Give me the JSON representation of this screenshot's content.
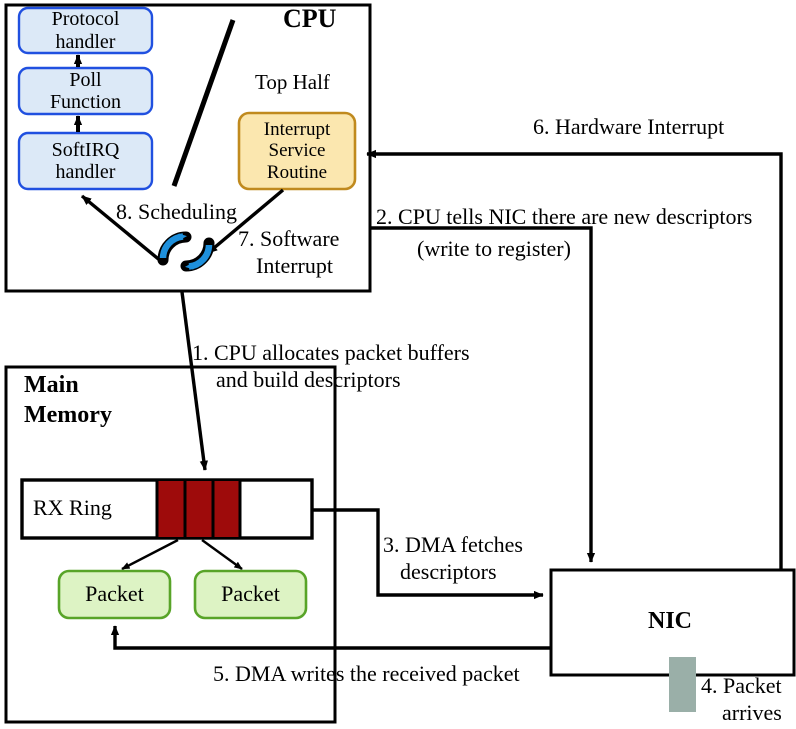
{
  "diagram": {
    "title": "NIC packet receive path (NAPI) block diagram",
    "colors": {
      "blue_fill": "#DCE9F7",
      "blue_stroke": "#2050E0",
      "yellow_fill": "#FBE7AF",
      "yellow_stroke": "#C08A1E",
      "green_fill": "#DDF3C4",
      "green_stroke": "#58A428",
      "red_fill": "#9E0B0B",
      "gray_fill": "#9AAFA8",
      "line": "#000000",
      "background": "#FFFFFF"
    }
  },
  "cpu": {
    "title": "CPU",
    "top_half_label": "Top Half",
    "blocks": [
      {
        "id": "protocol-handler",
        "label": "Protocol\nhandler"
      },
      {
        "id": "poll-function",
        "label": "Poll\nFunction"
      },
      {
        "id": "softirq-handler",
        "label": "SoftIRQ\nhandler"
      },
      {
        "id": "interrupt-service-routine",
        "label": "Interrupt\nService\nRoutine"
      }
    ],
    "step8": "8. Scheduling",
    "step7": "7. Software\nInterrupt",
    "napi_icon": "cycle-arrows-icon"
  },
  "memory": {
    "title": "Main\nMemory",
    "ring": {
      "label": "RX Ring",
      "total_cells": 8,
      "filled_cells": 3,
      "filled_start_index": 4
    },
    "packets": [
      {
        "id": "packet-left",
        "label": "Packet"
      },
      {
        "id": "packet-right",
        "label": "Packet"
      }
    ]
  },
  "nic": {
    "title": "NIC",
    "port_label": "port-connector"
  },
  "steps": [
    {
      "num": 1,
      "text": "1. CPU allocates packet buffers\n     and build descriptors"
    },
    {
      "num": 2,
      "text": "2. CPU tells NIC there are new descriptors\n            (write to register)"
    },
    {
      "num": 3,
      "text": "3. DMA fetches\n     descriptors"
    },
    {
      "num": 4,
      "text": "4. Packet\n    arrives"
    },
    {
      "num": 5,
      "text": "5. DMA writes the received packet"
    },
    {
      "num": 6,
      "text": "6. Hardware Interrupt"
    },
    {
      "num": 7,
      "text": "7. Software\n    Interrupt"
    },
    {
      "num": 8,
      "text": "8. Scheduling"
    }
  ],
  "step_labels": {
    "s1_line1": "1. CPU allocates packet buffers",
    "s1_line2": "and build descriptors",
    "s2_line1": "2. CPU tells NIC there are new descriptors",
    "s2_line2": "(write to register)",
    "s3_line1": "3. DMA fetches",
    "s3_line2": "descriptors",
    "s4_line1": "4. Packet",
    "s4_line2": "arrives",
    "s5": "5. DMA writes the received packet",
    "s6": "6. Hardware Interrupt",
    "s7_line1": "7. Software",
    "s7_line2": "Interrupt",
    "s8": "8. Scheduling"
  }
}
